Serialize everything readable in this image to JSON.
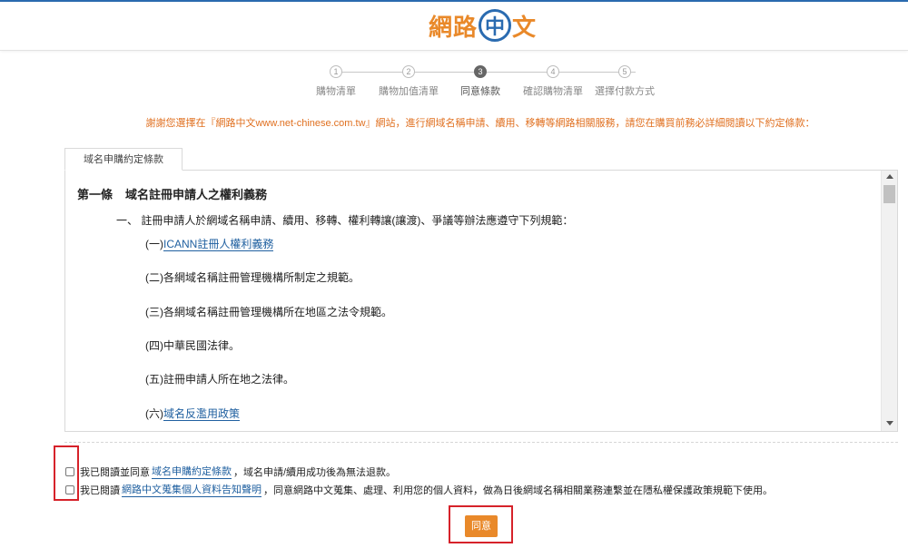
{
  "header": {
    "logo_part1": "網路",
    "logo_circle": "中",
    "logo_part2": "文"
  },
  "steps": [
    {
      "num": "1",
      "label": "購物清單",
      "active": false
    },
    {
      "num": "2",
      "label": "購物加值清單",
      "active": false
    },
    {
      "num": "3",
      "label": "同意條款",
      "active": true
    },
    {
      "num": "4",
      "label": "確認購物清單",
      "active": false
    },
    {
      "num": "5",
      "label": "選擇付款方式",
      "active": false
    }
  ],
  "notice": "謝謝您選擇在『網路中文www.net-chinese.com.tw』網站，進行網域名稱申請、續用、移轉等網路相關服務，請您在購買前務必詳細閱讀以下約定條款：",
  "tab_label": "域名申購約定條款",
  "terms": {
    "article_no": "第一條",
    "article_title": "域名註冊申請人之權利義務",
    "section": "一、  註冊申請人於網域名稱申請、續用、移轉、權利轉讓(讓渡)、爭議等辦法應遵守下列規範：",
    "items": [
      {
        "prefix": "(一)",
        "text": "ICANN註冊人權利義務",
        "link": true
      },
      {
        "prefix": "(二)",
        "text": "各網域名稱註冊管理機構所制定之規範。",
        "link": false
      },
      {
        "prefix": "(三)",
        "text": "各網域名稱註冊管理機構所在地區之法令規範。",
        "link": false
      },
      {
        "prefix": "(四)",
        "text": "中華民國法律。",
        "link": false
      },
      {
        "prefix": "(五)",
        "text": "註冊申請人所在地之法律。",
        "link": false
      },
      {
        "prefix": "(六)",
        "text": "域名反濫用政策",
        "link": true
      }
    ]
  },
  "agreements": [
    {
      "before": "我已閱讀並同意",
      "link": "域名申購約定條款",
      "after": "，域名申請/續用成功後為無法退款。"
    },
    {
      "before": "我已閱讀",
      "link": "網路中文蒐集個人資料告知聲明",
      "after": "，同意網路中文蒐集、處理、利用您的個人資料，做為日後網域名稱相關業務連繫並在隱私權保護政策規範下使用。"
    }
  ],
  "agree_button": "同意",
  "colors": {
    "accent_orange": "#e9892a",
    "link_blue": "#2060a0",
    "highlight_red": "#d6222a"
  }
}
